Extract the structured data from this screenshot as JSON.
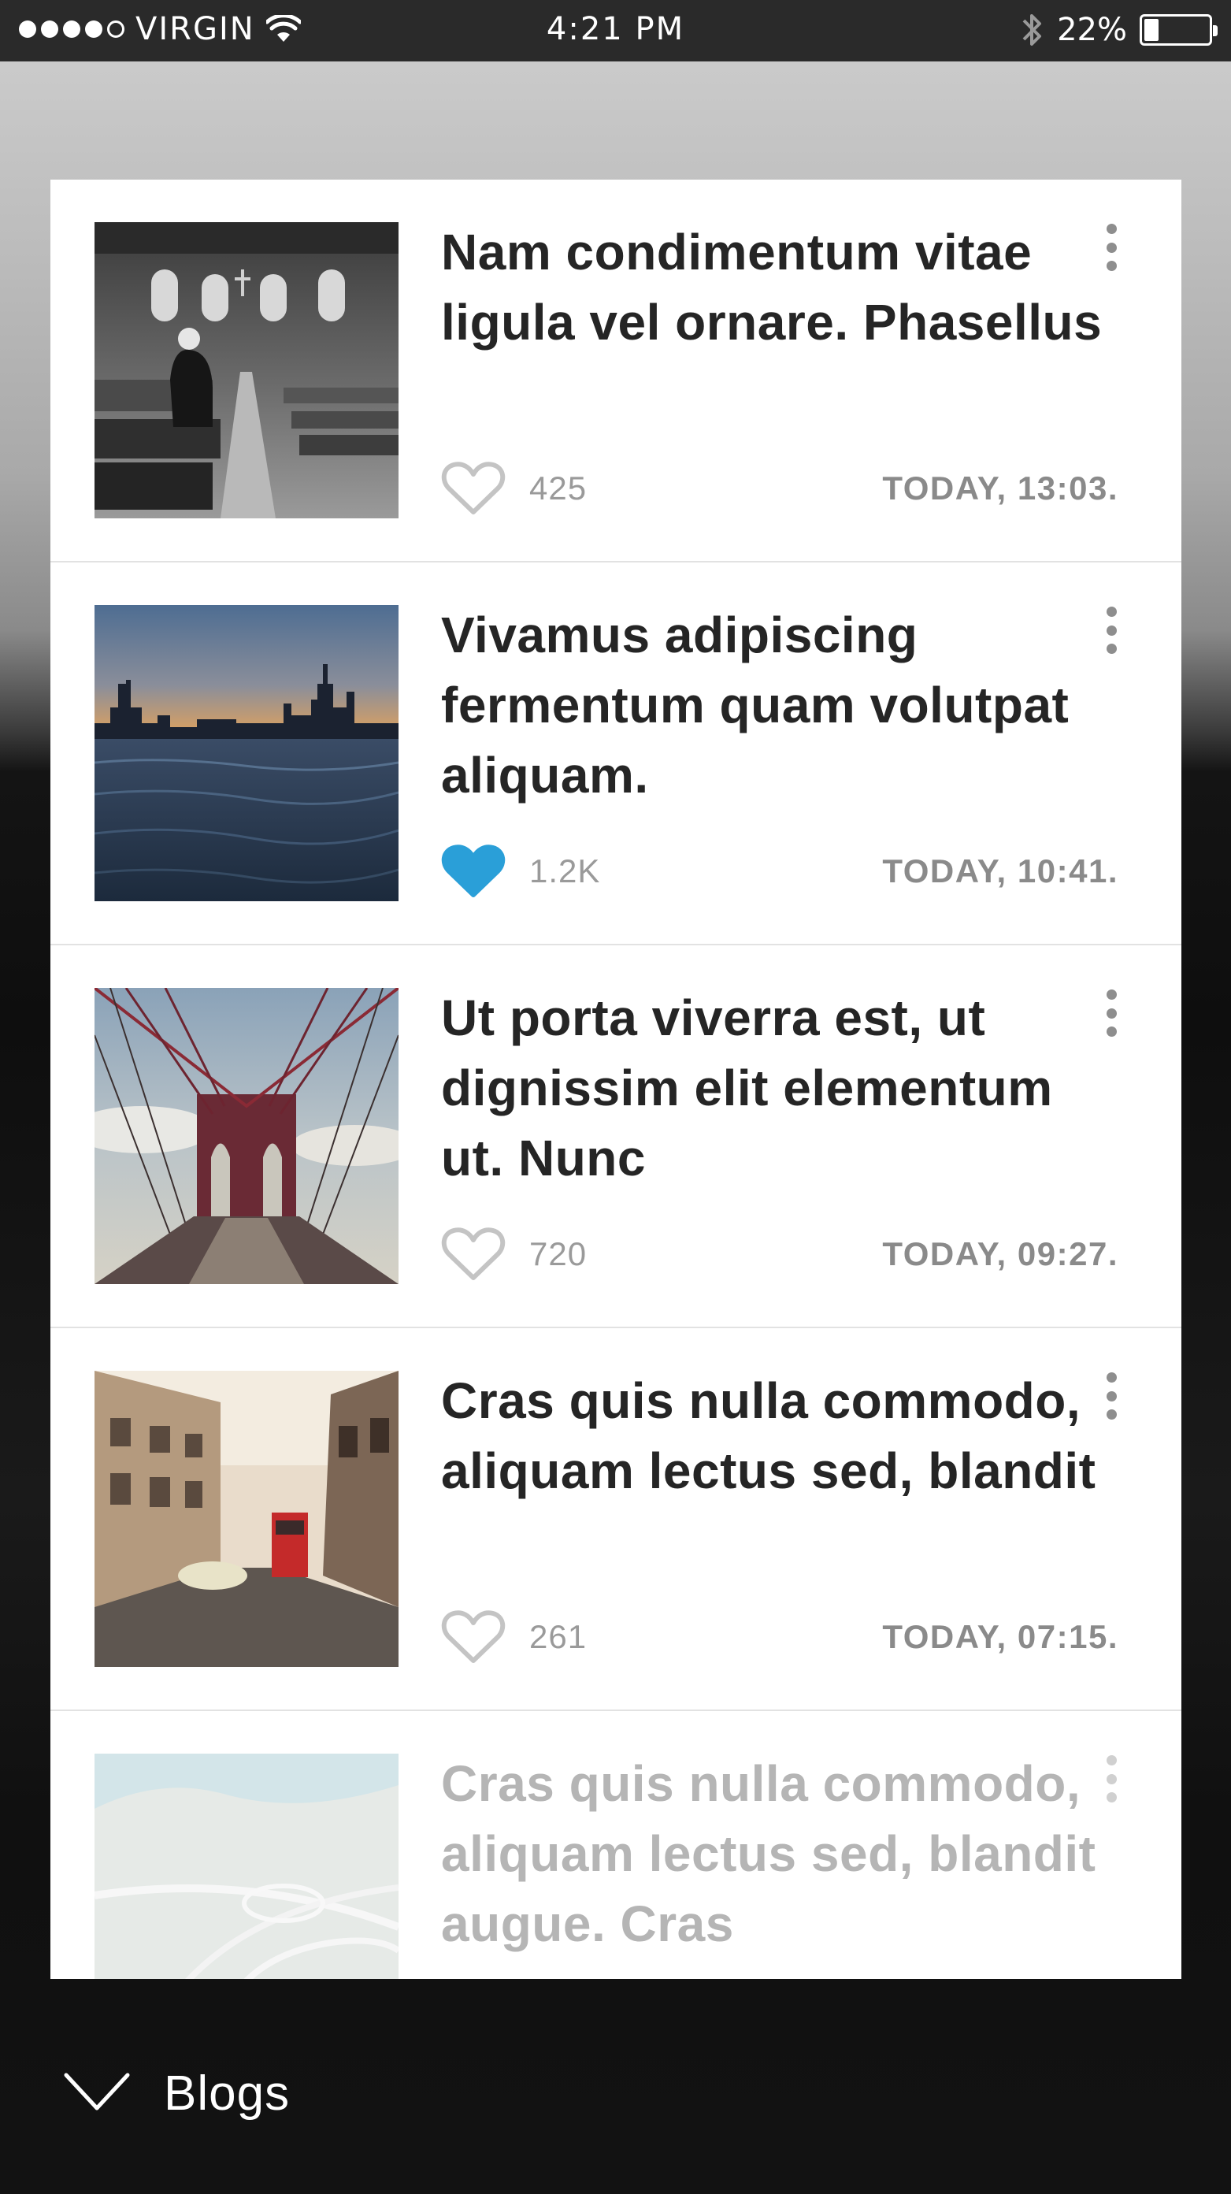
{
  "status_bar": {
    "carrier": "VIRGIN",
    "time": "4:21 PM",
    "battery": "22%",
    "signal_bars_filled": 4,
    "signal_bars_total": 5,
    "battery_level": 0.22,
    "icons": [
      "wifi-icon",
      "bluetooth-icon",
      "battery-icon"
    ]
  },
  "feed": {
    "items": [
      {
        "title": "Nam condimentum vitae ligula vel ornare. Phasellus",
        "likes": "425",
        "liked": false,
        "time": "TODAY, 13:03.",
        "thumbnail": "church-interior-photo"
      },
      {
        "title": "Vivamus adipiscing fermentum quam volutpat aliquam.",
        "likes": "1.2K",
        "liked": true,
        "time": "TODAY, 10:41.",
        "thumbnail": "city-skyline-sunset-photo"
      },
      {
        "title": "Ut porta viverra est, ut dignissim elit elementum ut. Nunc",
        "likes": "720",
        "liked": false,
        "time": "TODAY, 09:27.",
        "thumbnail": "brooklyn-bridge-photo"
      },
      {
        "title": "Cras quis nulla commodo, aliquam lectus sed, blandit",
        "likes": "261",
        "liked": false,
        "time": "TODAY, 07:15.",
        "thumbnail": "city-street-bus-photo"
      },
      {
        "title": "Cras quis nulla commodo, aliquam lectus sed, blandit augue. Cras",
        "likes": "",
        "liked": false,
        "time": "",
        "thumbnail": "highway-interchange-aerial-photo"
      }
    ]
  },
  "bottom": {
    "section_label": "Blogs"
  },
  "colors": {
    "liked_heart": "#2a9fd8",
    "unliked_heart": "#c4c4c4",
    "title_text": "#252525",
    "status_bar_bg": "#2a2a2a"
  }
}
